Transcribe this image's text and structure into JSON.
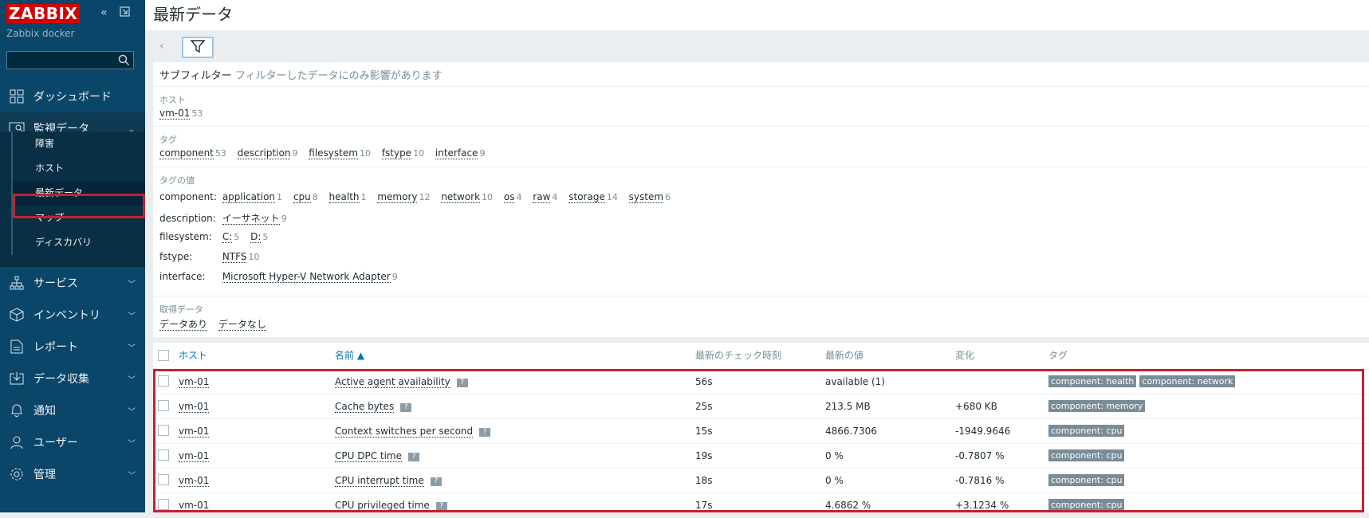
{
  "sidebar": {
    "logo": "ZABBIX",
    "server_name": "Zabbix docker",
    "nav": [
      {
        "label": "ダッシュボード",
        "icon": "dashboard-icon"
      },
      {
        "label": "監視データ",
        "icon": "monitoring-icon"
      },
      {
        "label": "サービス",
        "icon": "services-icon"
      },
      {
        "label": "インベントリ",
        "icon": "inventory-icon"
      },
      {
        "label": "レポート",
        "icon": "reports-icon"
      },
      {
        "label": "データ収集",
        "icon": "data-collection-icon"
      },
      {
        "label": "通知",
        "icon": "alerts-icon"
      },
      {
        "label": "ユーザー",
        "icon": "users-icon"
      },
      {
        "label": "管理",
        "icon": "administration-icon"
      }
    ],
    "subnav": [
      "障害",
      "ホスト",
      "最新データ",
      "マップ",
      "ディスカバリ"
    ]
  },
  "page": {
    "title": "最新データ"
  },
  "subfilter": {
    "heading": "サブフィルター",
    "note": "フィルターしたデータにのみ影響があります",
    "hosts": {
      "label": "ホスト",
      "items": [
        {
          "name": "vm-01",
          "count": "53"
        }
      ]
    },
    "tags": {
      "label": "タグ",
      "items": [
        {
          "name": "component",
          "count": "53"
        },
        {
          "name": "description",
          "count": "9"
        },
        {
          "name": "filesystem",
          "count": "10"
        },
        {
          "name": "fstype",
          "count": "10"
        },
        {
          "name": "interface",
          "count": "9"
        }
      ]
    },
    "tag_values": {
      "label": "タグの値",
      "rows": [
        {
          "key": "component:",
          "items": [
            {
              "name": "application",
              "count": "1"
            },
            {
              "name": "cpu",
              "count": "8"
            },
            {
              "name": "health",
              "count": "1"
            },
            {
              "name": "memory",
              "count": "12"
            },
            {
              "name": "network",
              "count": "10"
            },
            {
              "name": "os",
              "count": "4"
            },
            {
              "name": "raw",
              "count": "4"
            },
            {
              "name": "storage",
              "count": "14"
            },
            {
              "name": "system",
              "count": "6"
            }
          ]
        },
        {
          "key": "description:",
          "items": [
            {
              "name": "イーサネット",
              "count": "9"
            }
          ]
        },
        {
          "key": "filesystem:",
          "items": [
            {
              "name": "C:",
              "count": "5"
            },
            {
              "name": "D:",
              "count": "5"
            }
          ]
        },
        {
          "key": "fstype:",
          "items": [
            {
              "name": "NTFS",
              "count": "10"
            }
          ]
        },
        {
          "key": "interface:",
          "items": [
            {
              "name": "Microsoft Hyper-V Network Adapter",
              "count": "9"
            }
          ]
        }
      ]
    },
    "data": {
      "label": "取得データ",
      "items": [
        "データあり",
        "データなし"
      ]
    }
  },
  "table": {
    "headers": {
      "host": "ホスト",
      "name": "名前 ▲",
      "last_check": "最新のチェック時刻",
      "last_value": "最新の値",
      "change": "変化",
      "tags": "タグ"
    },
    "rows": [
      {
        "host": "vm-01",
        "name": "Active agent availability",
        "last_check": "56s",
        "last_value": "available (1)",
        "change": "",
        "tags": [
          "component: health",
          "component: network"
        ]
      },
      {
        "host": "vm-01",
        "name": "Cache bytes",
        "last_check": "25s",
        "last_value": "213.5 MB",
        "change": "+680 KB",
        "tags": [
          "component: memory"
        ]
      },
      {
        "host": "vm-01",
        "name": "Context switches per second",
        "last_check": "15s",
        "last_value": "4866.7306",
        "change": "-1949.9646",
        "tags": [
          "component: cpu"
        ]
      },
      {
        "host": "vm-01",
        "name": "CPU DPC time",
        "last_check": "19s",
        "last_value": "0 %",
        "change": "-0.7807 %",
        "tags": [
          "component: cpu"
        ]
      },
      {
        "host": "vm-01",
        "name": "CPU interrupt time",
        "last_check": "18s",
        "last_value": "0 %",
        "change": "-0.7816 %",
        "tags": [
          "component: cpu"
        ]
      },
      {
        "host": "vm-01",
        "name": "CPU privileged time",
        "last_check": "17s",
        "last_value": "4.6862 %",
        "change": "+3.1234 %",
        "tags": [
          "component: cpu"
        ]
      }
    ],
    "info_glyph": "?"
  }
}
